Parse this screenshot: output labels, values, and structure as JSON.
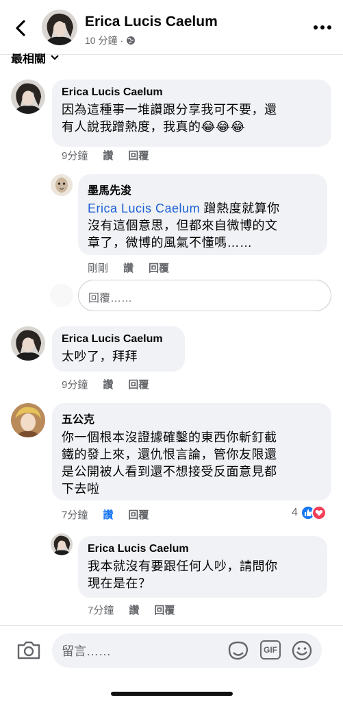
{
  "header": {
    "title": "Erica Lucis Caelum",
    "time": "10 分鐘",
    "dot": "·"
  },
  "sort_label": "最相關",
  "comments": [
    {
      "name": "Erica Lucis Caelum",
      "text_line1": "因為這種事一堆讚跟分享我可不要，還",
      "text_line2": "有人說我蹭熱度，我真的",
      "emoji": "😂😂😂",
      "time": "9分鐘",
      "like_label": "讚",
      "reply_label": "回覆"
    },
    {
      "name": "墨馬先浚",
      "mention": "Erica Lucis Caelum",
      "text_line1_rest": " 蹭熱度就算你",
      "text_line2": "沒有這個意思，但都來自微博的文",
      "text_line3": "章了，微博的風氣不懂嗎……",
      "time": "剛剛",
      "like_label": "讚",
      "reply_label": "回覆"
    },
    {
      "name": "Erica Lucis Caelum",
      "text_line1": "太吵了，拜拜",
      "time": "9分鐘",
      "like_label": "讚",
      "reply_label": "回覆"
    },
    {
      "name": "五公克",
      "text_line1": "你一個根本沒證據確鑿的東西你斬釘截",
      "text_line2": "鐵的發上來，還仇恨言論，管你友限還",
      "text_line3": "是公開被人看到還不想接受反面意見都",
      "text_line4": "下去啦",
      "time": "7分鐘",
      "like_label": "讚",
      "reply_label": "回覆",
      "reaction_count": "4"
    },
    {
      "name": "Erica Lucis Caelum",
      "text_line1": "我本就沒有要跟任何人吵，請問你",
      "text_line2": "現在是在？",
      "time": "7分鐘",
      "like_label": "讚",
      "reply_label": "回覆"
    }
  ],
  "reply_box": {
    "placeholder": "回覆……"
  },
  "footer": {
    "input_placeholder": "留言……",
    "gif_label": "GIF"
  },
  "colors": {
    "accent": "#1877f2",
    "mention": "#1b5fd6",
    "bubble": "#f0f2f5",
    "secondary_text": "#65676b",
    "heart": "#f33e58"
  },
  "icons": [
    "back-arrow-icon",
    "globe-icon",
    "more-icon",
    "chevron-down-icon",
    "camera-icon",
    "sticker-icon",
    "gif-icon",
    "smiley-icon",
    "like-icon",
    "heart-icon"
  ]
}
